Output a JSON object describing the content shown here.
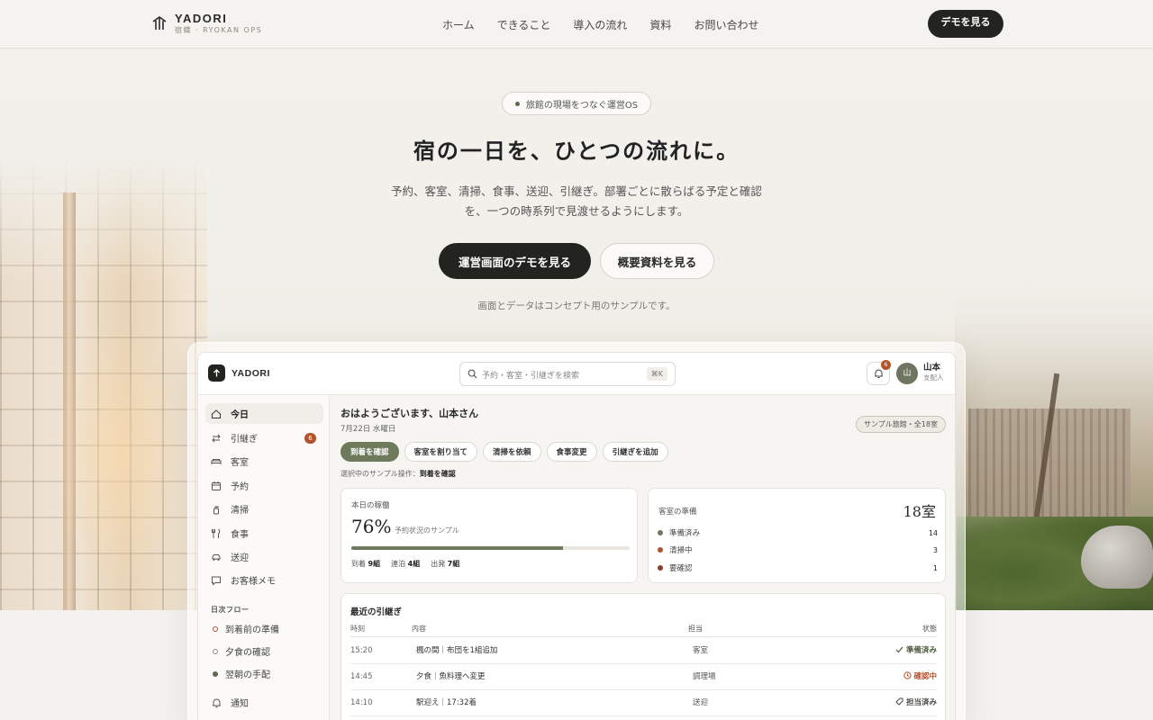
{
  "nav": {
    "brand": "YADORI",
    "brand_sub": "宿織 · RYOKAN OPS",
    "links": [
      "ホーム",
      "できること",
      "導入の流れ",
      "資料",
      "お問い合わせ"
    ],
    "cta": "デモを見る"
  },
  "hero": {
    "pill": "旅館の現場をつなぐ運営OS",
    "title": "宿の一日を、ひとつの流れに。",
    "desc_line1": "予約、客室、清掃、食事、送迎、引継ぎ。部署ごとに散らばる予定と確認",
    "desc_line2": "を、一つの時系列で見渡せるようにします。",
    "primary_cta": "運営画面のデモを見る",
    "secondary_cta": "概要資料を見る",
    "note": "画面とデータはコンセプト用のサンプルです。"
  },
  "app": {
    "name": "YADORI",
    "search_placeholder": "予約・客室・引継ぎを検索",
    "search_shortcut": "⌘K",
    "notification_count": "6",
    "user_initial": "山",
    "user_name": "山本",
    "user_role": "支配人",
    "sidebar": {
      "items": [
        {
          "label": "今日",
          "icon": "home-icon"
        },
        {
          "label": "引継ぎ",
          "icon": "swap-icon",
          "badge": "6"
        },
        {
          "label": "客室",
          "icon": "bed-icon"
        },
        {
          "label": "予約",
          "icon": "calendar-icon"
        },
        {
          "label": "清掃",
          "icon": "spray-icon"
        },
        {
          "label": "食事",
          "icon": "utensils-icon"
        },
        {
          "label": "送迎",
          "icon": "car-icon"
        },
        {
          "label": "お客様メモ",
          "icon": "chat-icon"
        }
      ],
      "flow_title": "日次フロー",
      "flow": [
        "到着前の準備",
        "夕食の確認",
        "翌朝の手配"
      ],
      "notify": "通知"
    },
    "main": {
      "greeting": "おはようございます、山本さん",
      "date": "7月22日 水曜日",
      "sample_tag": "サンプル旅館・全18室",
      "actions": [
        "到着を確認",
        "客室を割り当て",
        "清掃を依頼",
        "食事変更",
        "引継ぎを追加"
      ],
      "selected_prefix": "選択中のサンプル操作：",
      "selected_action": "到着を確認",
      "occupancy": {
        "label": "本日の稼働",
        "rate": "76%",
        "rate_value": 0.76,
        "sub": "予約状況のサンプル",
        "arrivals_label": "到着",
        "arrivals": "9組",
        "stay_label": "連泊",
        "stay": "4組",
        "depart_label": "出発",
        "depart": "7組"
      },
      "rooms": {
        "label": "客室の準備",
        "total": "18室",
        "statuses": [
          {
            "label": "準備済み",
            "count": "14",
            "color": "#6e7a5c"
          },
          {
            "label": "清掃中",
            "count": "3",
            "color": "#b3532b"
          },
          {
            "label": "要確認",
            "count": "1",
            "color": "#8e3f2a"
          }
        ]
      },
      "handoffs": {
        "title": "最近の引継ぎ",
        "columns": [
          "時刻",
          "内容",
          "担当",
          "状態"
        ],
        "rows": [
          {
            "time": "15:20",
            "content": "楓の間｜布団を1組追加",
            "owner": "客室",
            "status": "準備済み",
            "status_icon": "check-icon"
          },
          {
            "time": "14:45",
            "content": "夕食｜魚料理へ変更",
            "owner": "調理場",
            "status": "確認中",
            "status_icon": "clock-icon"
          },
          {
            "time": "14:10",
            "content": "駅迎え｜17:32着",
            "owner": "送迎",
            "status": "担当済み",
            "status_icon": "tag-icon"
          }
        ]
      }
    }
  }
}
